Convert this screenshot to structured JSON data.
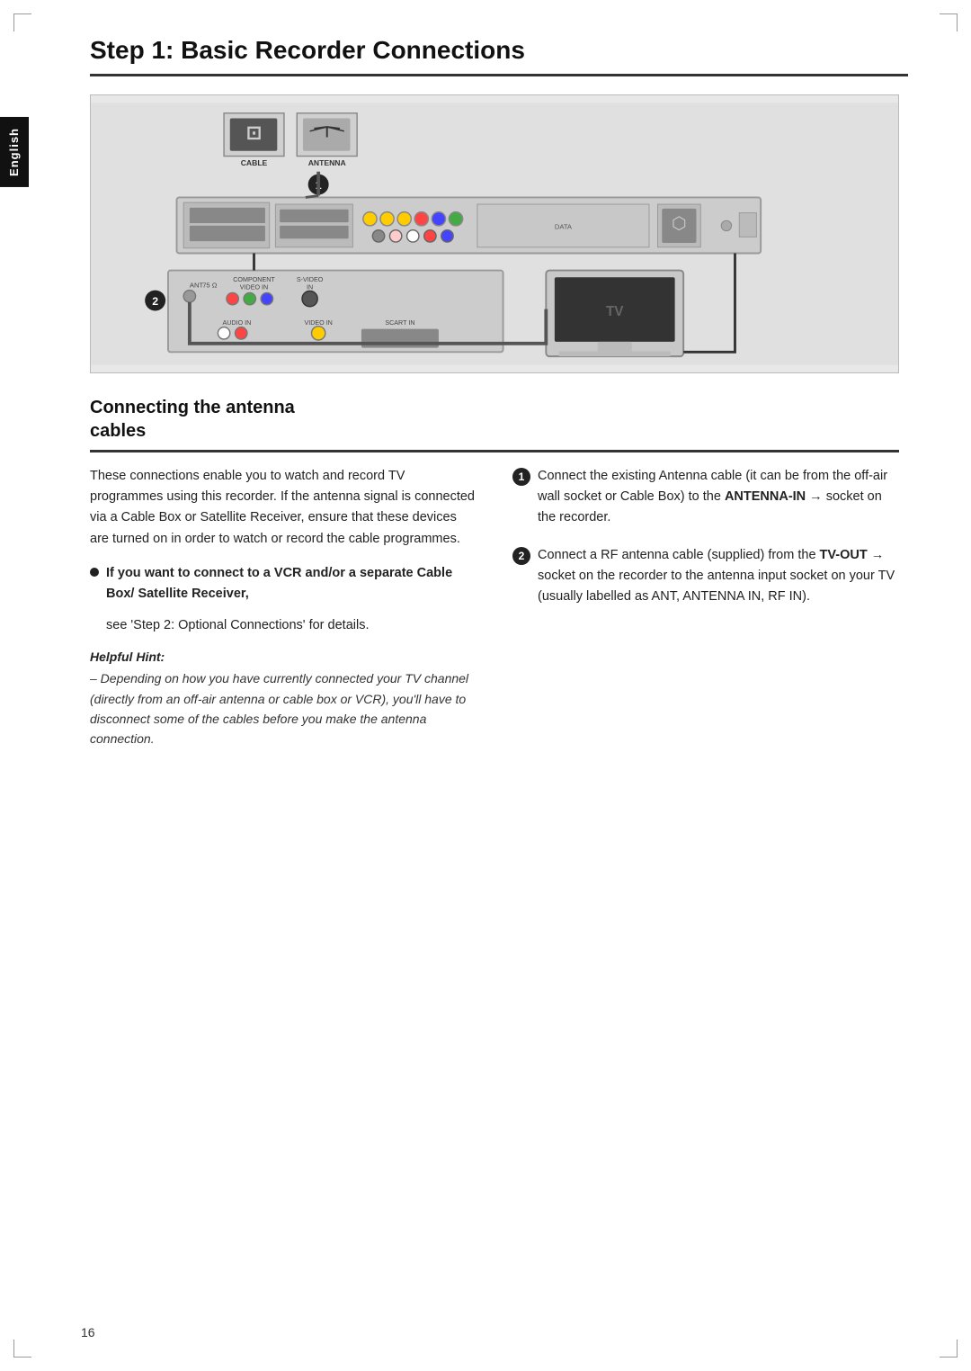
{
  "page": {
    "title": "Step 1: Basic Recorder Connections",
    "page_number": "16",
    "language_tab": "English"
  },
  "section": {
    "heading_line1": "Connecting the antenna",
    "heading_line2": "cables"
  },
  "left_column": {
    "body_text": "These connections enable you to watch and record TV programmes using this recorder. If the antenna signal is connected via a Cable Box or Satellite Receiver, ensure that these devices are turned on in order to watch or record the cable programmes.",
    "bullet_heading": "If you want to connect to a VCR and/or a separate Cable Box/ Satellite Receiver,",
    "bullet_sub": "see 'Step 2: Optional Connections' for details.",
    "helpful_hint_label": "Helpful Hint:",
    "helpful_hint_text": "– Depending on how you have currently connected your TV channel (directly from an off-air antenna or cable box or VCR), you'll have to disconnect some of the cables before you make the antenna connection."
  },
  "right_column": {
    "step1_text": "Connect the existing Antenna cable (it can be from the off-air wall socket or Cable Box) to the ",
    "step1_bold": "ANTENNA-IN",
    "step1_suffix": " socket on the recorder.",
    "step2_text": "Connect a RF antenna cable (supplied) from the ",
    "step2_bold": "TV-OUT",
    "step2_suffix": " socket on the recorder to the antenna input socket on your TV (usually labelled as ANT, ANTENNA IN, RF IN)."
  },
  "diagram": {
    "label_cable": "CABLE",
    "label_antenna": "ANTENNA",
    "label_tv": "TV",
    "label_scart_in": "SCART IN",
    "label_audio_in": "AUDIO IN",
    "label_video_in": "VIDEO IN",
    "label_s_video_in": "S-VIDEO IN",
    "label_component_video_in": "COMPONENT VIDEO IN",
    "number1": "1",
    "number2": "2"
  }
}
